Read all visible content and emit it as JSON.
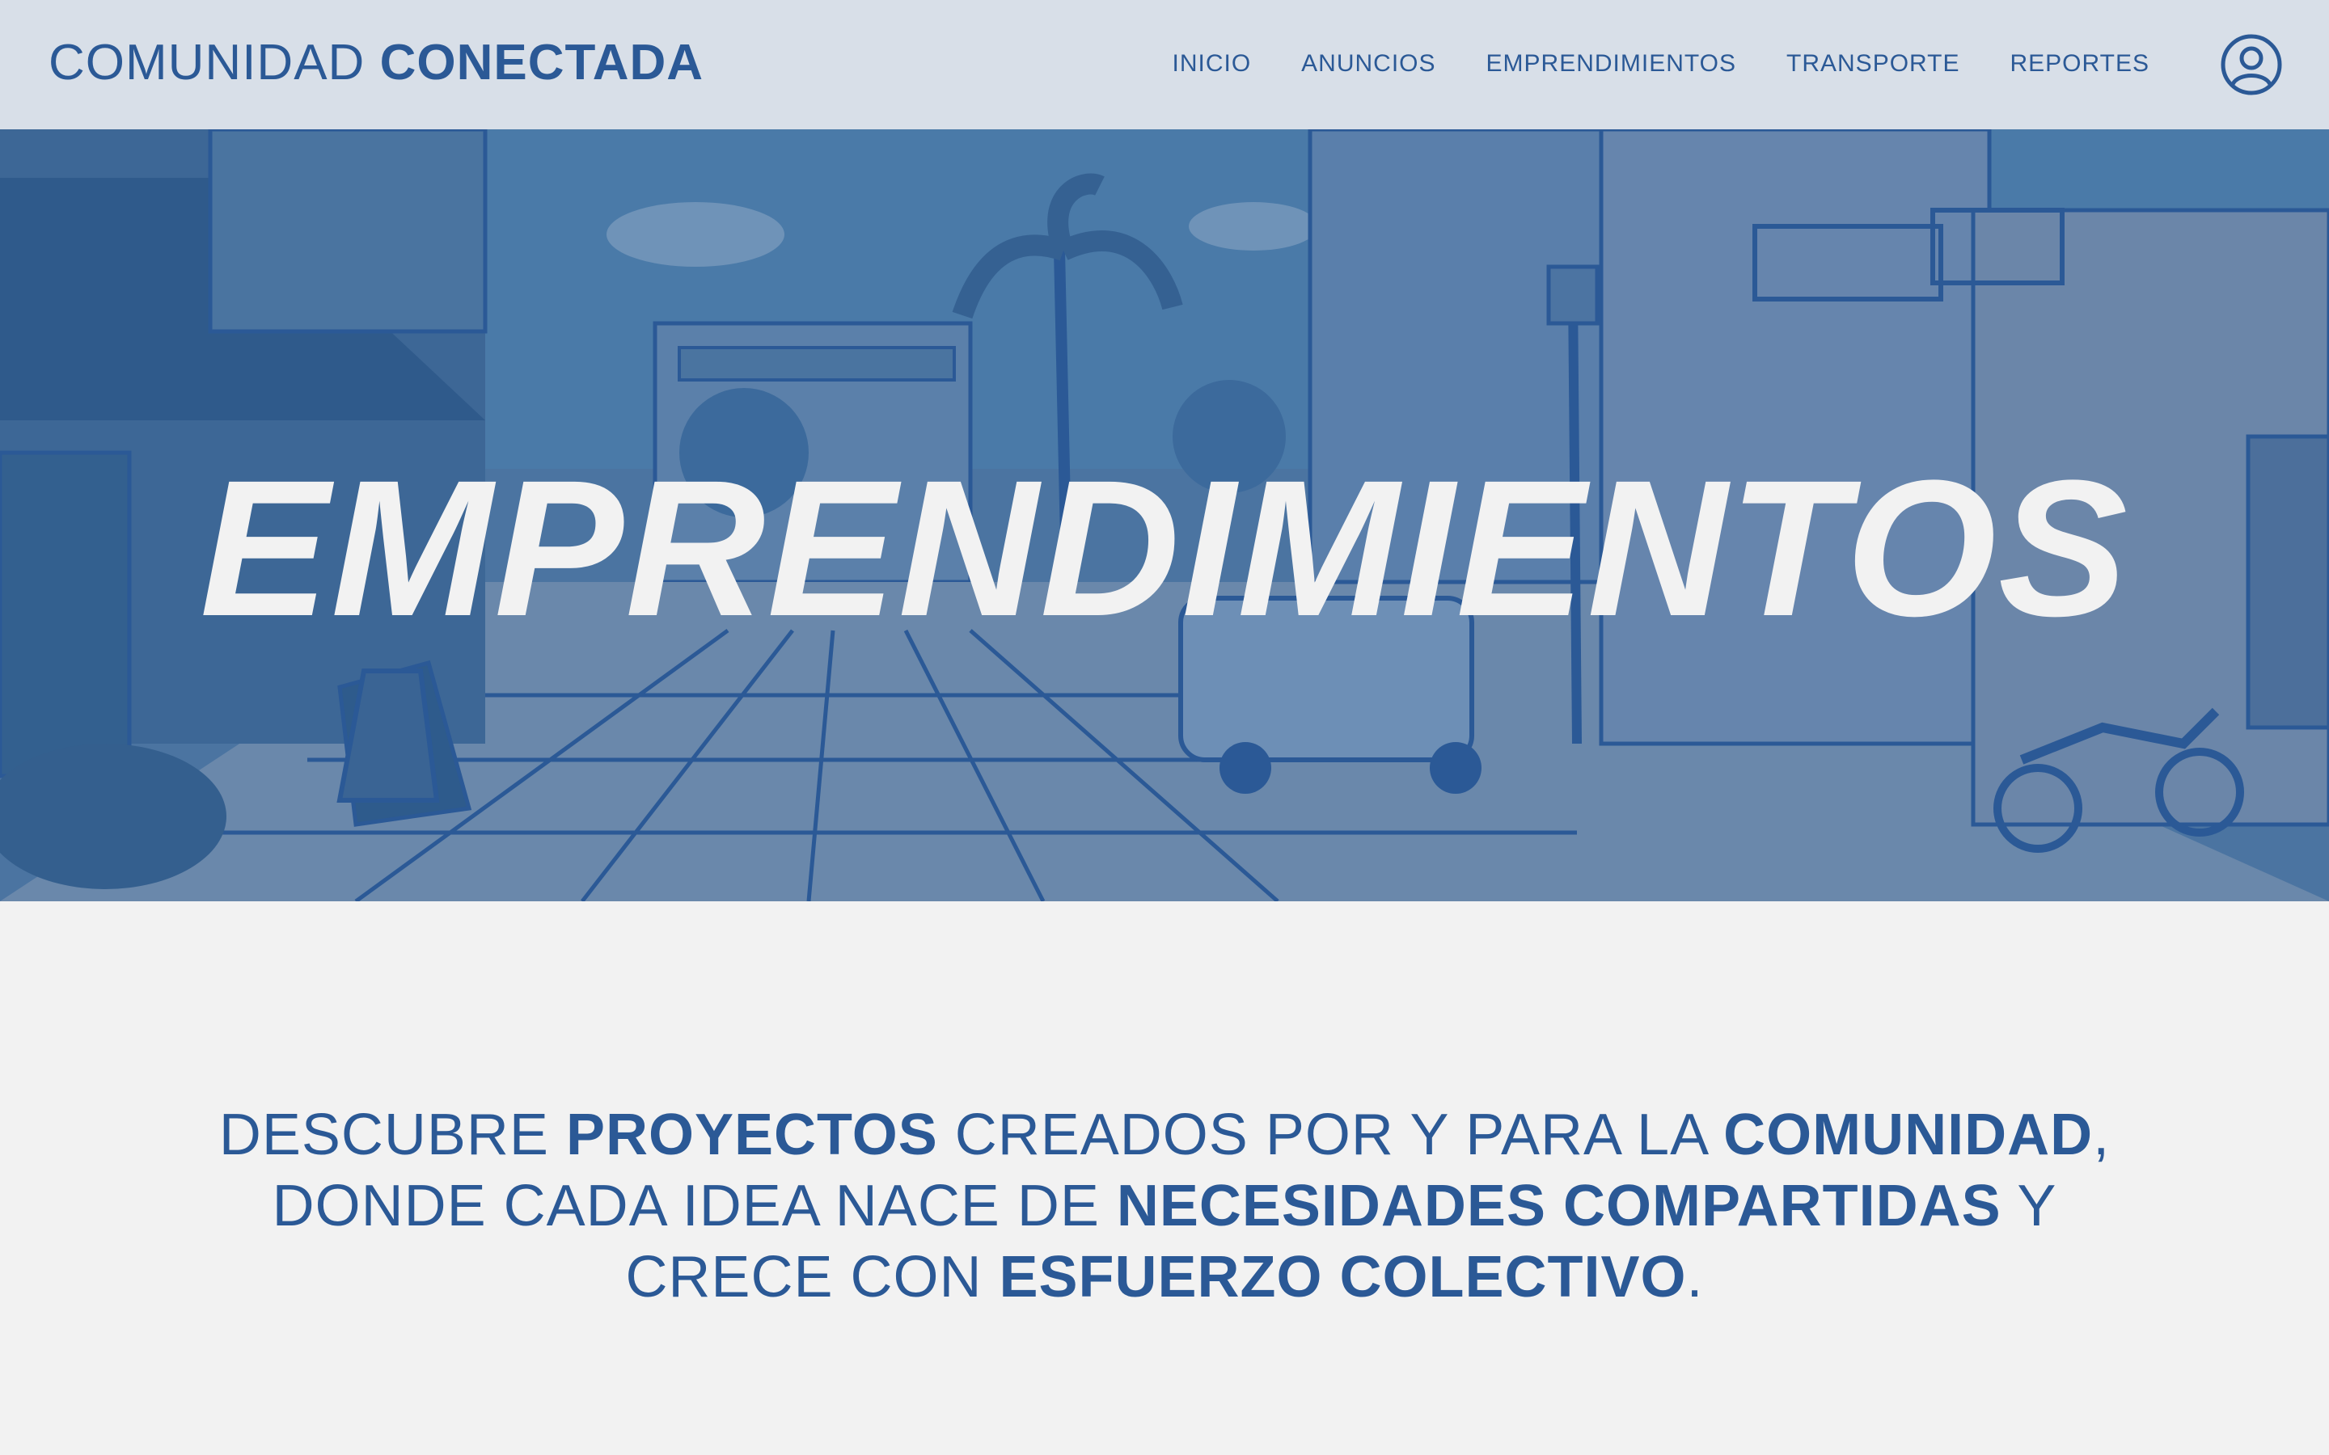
{
  "header": {
    "brand_light": "COMUNIDAD ",
    "brand_bold": "CONECTADA",
    "nav": [
      "INICIO",
      "ANUNCIOS",
      "EMPRENDIMIENTOS",
      "TRANSPORTE",
      "REPORTES"
    ],
    "profile_icon": "user-circle-icon"
  },
  "hero": {
    "title": "EMPRENDIMIENTOS",
    "image": "street-illustration"
  },
  "intro": {
    "p1": "DESCUBRE ",
    "b1": "PROYECTOS",
    "p2": " CREADOS POR Y PARA LA ",
    "b2": "COMUNIDAD",
    "p3": ", DONDE CADA IDEA NACE DE ",
    "b3": "NECESIDADES COMPARTIDAS",
    "p4": " Y CRECE CON ",
    "b4": "ESFUERZO COLECTIVO",
    "p5": "."
  },
  "colors": {
    "primary": "#2b5996",
    "header_bg": "#d8dfe8",
    "page_bg": "#f2f2f2",
    "hero_overlay": "#4b73a0"
  }
}
